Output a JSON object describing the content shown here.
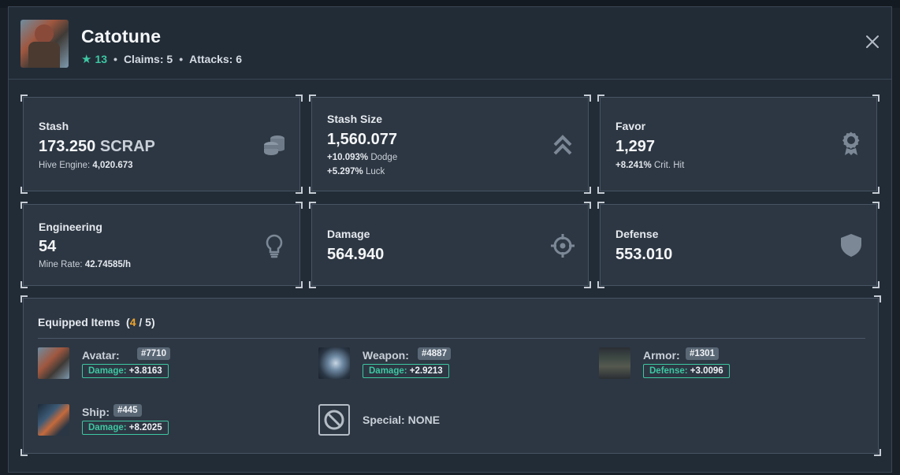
{
  "header": {
    "title": "Catotune",
    "stars": "13",
    "claims": "Claims: 5",
    "attacks": "Attacks: 6",
    "separator": "•",
    "close_icon": "close-icon"
  },
  "cards": {
    "stash": {
      "label": "Stash",
      "value": "173.250",
      "unit": "SCRAP",
      "sub_key": "Hive Engine:",
      "sub_val": "4,020.673",
      "icon": "coins-icon"
    },
    "stash_size": {
      "label": "Stash Size",
      "value": "1,560.077",
      "sub1_val": "+10.093%",
      "sub1_key": "Dodge",
      "sub2_val": "+5.297%",
      "sub2_key": "Luck",
      "icon": "double-chevron-up-icon"
    },
    "favor": {
      "label": "Favor",
      "value": "1,297",
      "sub_val": "+8.241%",
      "sub_key": "Crit. Hit",
      "icon": "medal-icon"
    },
    "engineering": {
      "label": "Engineering",
      "value": "54",
      "sub_key": "Mine Rate:",
      "sub_val": "42.74585/h",
      "icon": "lightbulb-icon"
    },
    "damage": {
      "label": "Damage",
      "value": "564.940",
      "icon": "crosshair-icon"
    },
    "defense": {
      "label": "Defense",
      "value": "553.010",
      "icon": "shield-icon"
    }
  },
  "equipped": {
    "title": "Equipped Items",
    "open_paren": "(",
    "current": "4",
    "slash_total": "/ 5)",
    "items": [
      {
        "name": "Avatar:",
        "id": "#7710",
        "stat_key": "Damage:",
        "stat_val": "+3.8163"
      },
      {
        "name": "Weapon:",
        "id": "#4887",
        "stat_key": "Damage:",
        "stat_val": "+2.9213"
      },
      {
        "name": "Armor:",
        "id": "#1301",
        "stat_key": "Defense:",
        "stat_val": "+3.0096"
      },
      {
        "name": "Ship:",
        "id": "#445",
        "stat_key": "Damage:",
        "stat_val": "+8.2025"
      }
    ],
    "special": {
      "label": "Special: NONE",
      "icon": "no-symbol-icon"
    }
  },
  "colors": {
    "accent": "#3ec7a2",
    "highlight": "#f0a52a",
    "panel": "#2d3743",
    "background": "#222c37"
  }
}
